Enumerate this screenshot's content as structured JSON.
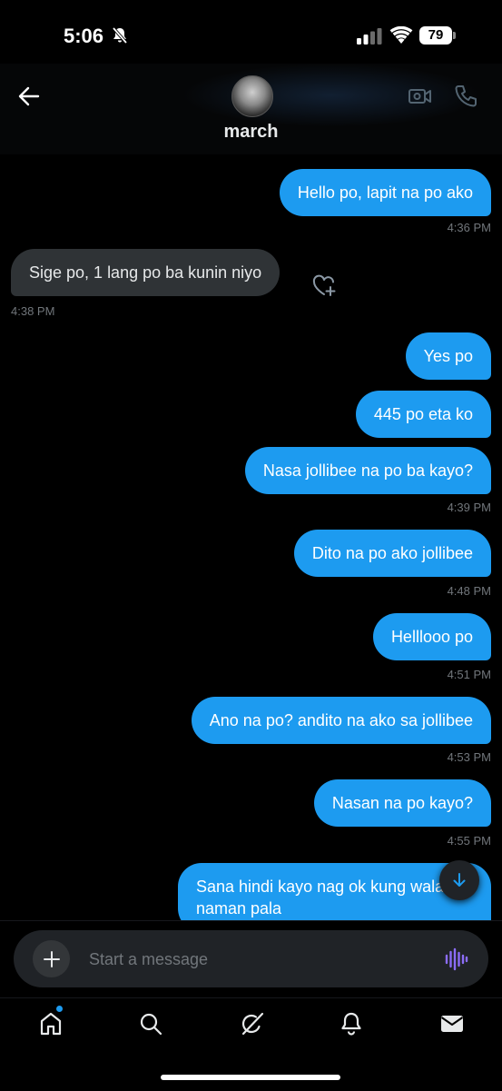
{
  "status_bar": {
    "time": "5:06",
    "battery": "79"
  },
  "header": {
    "contact_name": "march"
  },
  "messages": [
    {
      "text": "Hello po, lapit na po ako",
      "time": "4:36 PM"
    },
    {
      "text": "Sige po, 1 lang po ba kunin niyo",
      "time": "4:38 PM"
    },
    {
      "text": "Yes po"
    },
    {
      "text": "445 po eta ko"
    },
    {
      "text": "Nasa jollibee na po ba kayo?",
      "time": "4:39 PM"
    },
    {
      "text": "Dito na po ako jollibee",
      "time": "4:48 PM"
    },
    {
      "text": "Helllooo po",
      "time": "4:51 PM"
    },
    {
      "text": "Ano na po? andito na ako sa jollibee",
      "time": "4:53 PM"
    },
    {
      "text": "Nasan na po kayo?",
      "time": "4:55 PM"
    },
    {
      "text": "Sana hindi kayo nag ok kung wala din naman pala"
    }
  ],
  "composer": {
    "placeholder": "Start a message"
  },
  "icons": {
    "back": "arrow-left-icon",
    "video": "video-call-icon",
    "phone": "phone-icon",
    "react": "heart-plus-icon",
    "scroll": "arrow-down-icon",
    "add": "plus-icon",
    "voice": "voice-wave-icon",
    "home": "home-icon",
    "search": "search-icon",
    "grok": "grok-icon",
    "notifications": "bell-icon",
    "messages": "envelope-icon"
  },
  "colors": {
    "accent": "#1d9bf0",
    "incoming_bubble": "#2f3336",
    "voice": "#8b6cf6",
    "background": "#000000"
  }
}
